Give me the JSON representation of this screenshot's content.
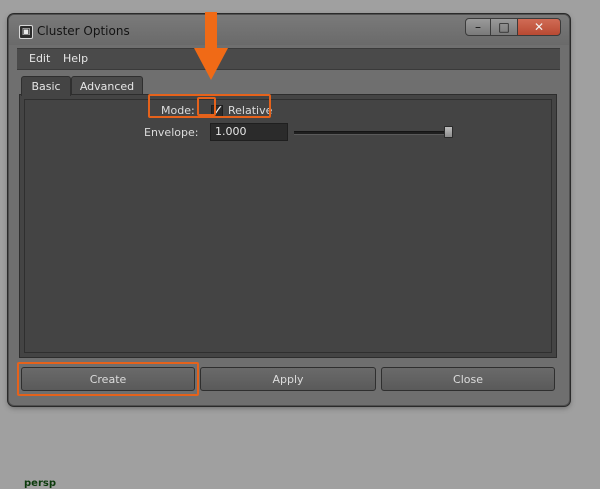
{
  "window": {
    "title": "Cluster Options",
    "controls": {
      "minimize": "–",
      "maximize": "□",
      "close": "✕"
    }
  },
  "menu": {
    "items": [
      "Edit",
      "Help"
    ]
  },
  "tabs": [
    {
      "label": "Basic",
      "active": true
    },
    {
      "label": "Advanced",
      "active": false
    }
  ],
  "options": {
    "mode": {
      "label": "Mode:",
      "checkbox_label": "Relative",
      "checked": true
    },
    "envelope": {
      "label": "Envelope:",
      "value": "1.000",
      "slider_fraction": 1.0
    }
  },
  "buttons": {
    "create": "Create",
    "apply": "Apply",
    "close": "Close"
  },
  "viewport": {
    "label": "persp"
  },
  "colors": {
    "highlight": "#e5621b",
    "arrow": "#f06a16"
  },
  "icons": {
    "app": "maya-icon",
    "checkmark": "checkmark-icon"
  }
}
